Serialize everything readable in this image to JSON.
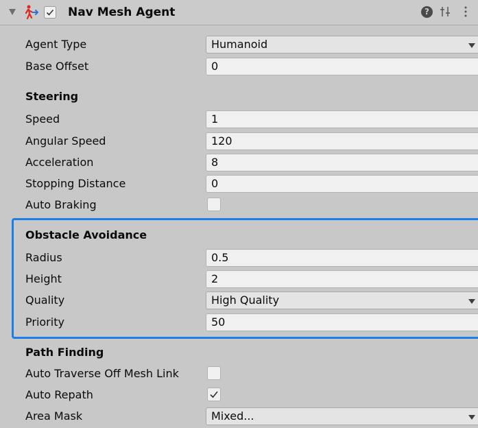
{
  "component": {
    "title": "Nav Mesh Agent",
    "enabled": true,
    "icons": [
      "foldout-arrow-icon",
      "nav-mesh-agent-icon",
      "help-icon",
      "presets-icon",
      "menu-icon"
    ]
  },
  "fields": {
    "agent_type": {
      "label": "Agent Type",
      "value": "Humanoid"
    },
    "base_offset": {
      "label": "Base Offset",
      "value": "0"
    }
  },
  "steering": {
    "header": "Steering",
    "speed": {
      "label": "Speed",
      "value": "1"
    },
    "angular_speed": {
      "label": "Angular Speed",
      "value": "120"
    },
    "acceleration": {
      "label": "Acceleration",
      "value": "8"
    },
    "stopping_distance": {
      "label": "Stopping Distance",
      "value": "0"
    },
    "auto_braking": {
      "label": "Auto Braking",
      "checked": false
    }
  },
  "obstacle_avoidance": {
    "header": "Obstacle Avoidance",
    "radius": {
      "label": "Radius",
      "value": "0.5"
    },
    "height": {
      "label": "Height",
      "value": "2"
    },
    "quality": {
      "label": "Quality",
      "value": "High Quality"
    },
    "priority": {
      "label": "Priority",
      "value": "50"
    }
  },
  "path_finding": {
    "header": "Path Finding",
    "auto_traverse": {
      "label": "Auto Traverse Off Mesh Link",
      "checked": false
    },
    "auto_repath": {
      "label": "Auto Repath",
      "checked": true
    },
    "area_mask": {
      "label": "Area Mask",
      "value": "Mixed..."
    }
  },
  "colors": {
    "highlight": "#1a7fe6",
    "background": "#c8c8c8",
    "agent_icon_red": "#e0261d",
    "agent_icon_blue": "#2f6fd8"
  }
}
